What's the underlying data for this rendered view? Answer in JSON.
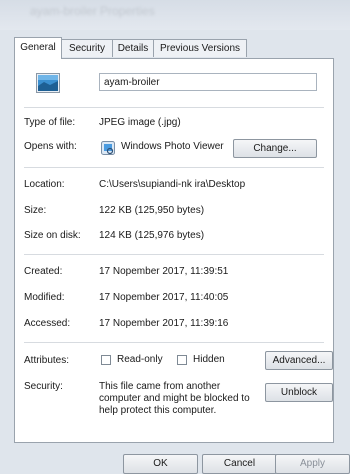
{
  "window": {
    "title": "ayam-broiler Properties"
  },
  "tabs": [
    "General",
    "Security",
    "Details",
    "Previous Versions"
  ],
  "general": {
    "file_name": "ayam-broiler",
    "type_label": "Type of file:",
    "type_value": "JPEG image (.jpg)",
    "opens_label": "Opens with:",
    "opens_value": "Windows Photo Viewer",
    "change_button": "Change...",
    "location_label": "Location:",
    "location_value": "C:\\Users\\supiandi-nk ira\\Desktop",
    "size_label": "Size:",
    "size_value": "122 KB (125,950 bytes)",
    "size_disk_label": "Size on disk:",
    "size_disk_value": "124 KB (125,976 bytes)",
    "created_label": "Created:",
    "created_value": "17 Nopember 2017, 11:39:51",
    "modified_label": "Modified:",
    "modified_value": "17 Nopember 2017, 11:40:05",
    "accessed_label": "Accessed:",
    "accessed_value": "17 Nopember 2017, 11:39:16",
    "attributes_label": "Attributes:",
    "readonly_label": "Read-only",
    "hidden_label": "Hidden",
    "advanced_button": "Advanced...",
    "security_label": "Security:",
    "security_text": "This file came from another computer and might be blocked to help protect this computer.",
    "unblock_button": "Unblock"
  },
  "footer": {
    "ok": "OK",
    "cancel": "Cancel",
    "apply": "Apply"
  },
  "colors": {
    "panel_bg": "#ffffff",
    "window_bg": "#dfe5ec",
    "border": "#9aa3ad"
  }
}
